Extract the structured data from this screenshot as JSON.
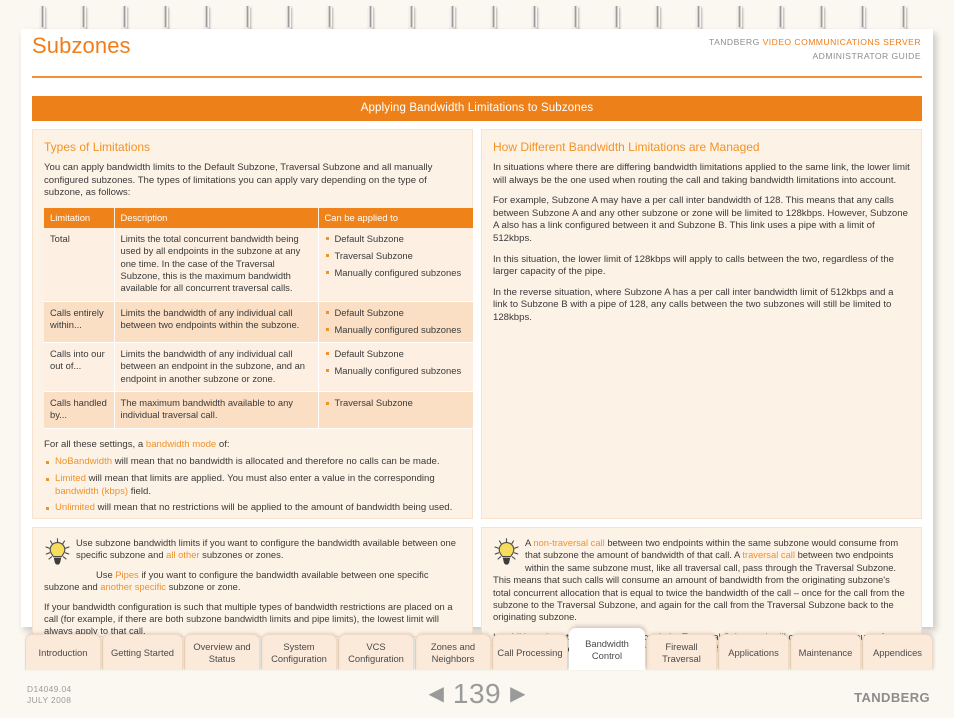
{
  "document": {
    "title": "Subzones",
    "header_company": "TANDBERG ",
    "header_product": "VIDEO COMMUNICATIONS SERVER",
    "header_subtitle": "ADMINISTRATOR GUIDE",
    "banner": "Applying Bandwidth Limitations to Subzones"
  },
  "left": {
    "section_title": "Types of Limitations",
    "intro": "You can apply bandwidth limits to the Default Subzone, Traversal Subzone and all manually configured subzones.  The types of limitations you can apply vary depending on the type of subzone, as follows:",
    "table": {
      "headers": [
        "Limitation",
        "Description",
        "Can be applied to"
      ],
      "rows": [
        {
          "limitation": "Total",
          "description": "Limits the total concurrent bandwidth being used by all endpoints in the subzone at any one time.  In the case of the Traversal Subzone, this is the maximum bandwidth available for all concurrent traversal calls.",
          "applies": [
            "Default Subzone",
            "Traversal Subzone",
            "Manually configured subzones"
          ]
        },
        {
          "limitation": "Calls entirely within...",
          "description": "Limits the bandwidth of any individual call between two endpoints within the subzone.",
          "applies": [
            "Default Subzone",
            "Manually configured subzones"
          ]
        },
        {
          "limitation": "Calls into our out of...",
          "description": "Limits the bandwidth of any individual call between an endpoint in the subzone, and an endpoint in another subzone or zone.",
          "applies": [
            "Default Subzone",
            "Manually configured subzones"
          ]
        },
        {
          "limitation": "Calls handled by...",
          "description": "The maximum bandwidth available to any individual traversal call.",
          "applies": [
            "Traversal Subzone"
          ]
        }
      ]
    },
    "modes_intro_a": "For all these settings, a ",
    "modes_intro_link": "bandwidth mode",
    "modes_intro_b": " of:",
    "modes": [
      {
        "term": "NoBandwidth",
        "rest": " will mean that no bandwidth is allocated and therefore no calls can be made."
      },
      {
        "term": "Limited",
        "rest": " will mean that limits are applied.  You must also enter a value in the corresponding ",
        "link2": "bandwidth (kbps)",
        "rest2": " field."
      },
      {
        "term": "Unlimited",
        "rest": " will mean that no restrictions will be applied to the amount of bandwidth being used."
      }
    ]
  },
  "right": {
    "section_title": "How Different Bandwidth Limitations are Managed",
    "paragraphs": [
      "In situations where there are differing bandwidth limitations applied to the same link, the lower limit will always be the one used when routing the call and taking bandwidth limitations into account.",
      "For example, Subzone A may have a per call inter bandwidth of 128.  This means that any calls between Subzone A and any other subzone or zone will be limited to 128kbps.  However, Subzone A also has a link configured between it and Subzone B.  This link uses a pipe with a limit of 512kbps.",
      "In this situation, the lower limit of 128kbps will apply to calls between the two, regardless of the larger capacity of the pipe.",
      "In the reverse situation, where Subzone A has a per call inter bandwidth limit of 512kbps and a link to Subzone B with a pipe of 128, any calls between the two subzones will still be limited to 128kbps."
    ]
  },
  "tip_left": {
    "icon": "lightbulb-icon",
    "p1_a": "Use subzone bandwidth limits if you want to configure the bandwidth available between one specific subzone and ",
    "p1_link": "all other",
    "p1_b": " subzones or zones.",
    "p2_a": "Use ",
    "p2_link": "Pipes",
    "p2_b": " if you want to configure the bandwidth available between one specific subzone and ",
    "p2_link2": "another specific",
    "p2_c": " subzone or zone.",
    "p3": "If your bandwidth configuration is such that multiple types of bandwidth restrictions are placed on a call (for example, if there are both subzone bandwidth limits and pipe limits), the lowest limit will always apply to that call."
  },
  "tip_right": {
    "icon": "lightbulb-icon",
    "p1_a": "A ",
    "p1_link": "non-traversal call",
    "p1_b": " between two endpoints within the same subzone would consume from that subzone the amount of bandwidth of that call.  A ",
    "p1_link2": "traversal call",
    "p1_c": " between two endpoints within the same subzone must, like all traversal call, pass through the Traversal Subzone. This means that such calls will consume an amount of bandwidth from the originating subzone's total concurrent allocation that is equal to twice the bandwidth of the call – once for the call from the subzone to the Traversal Subzone, and again for the call from the Traversal Subzone back to the originating subzone.",
    "p2": "In addition, since this call passes through the Traversal Subzone, it will consume an amount of bandwidth from the Traversal Subzone equal to that of the call."
  },
  "tabs": [
    {
      "label": "Introduction",
      "active": false
    },
    {
      "label": "Getting Started",
      "active": false
    },
    {
      "label": "Overview and Status",
      "active": false
    },
    {
      "label": "System Configuration",
      "active": false
    },
    {
      "label": "VCS Configuration",
      "active": false
    },
    {
      "label": "Zones and Neighbors",
      "active": false
    },
    {
      "label": "Call Processing",
      "active": false
    },
    {
      "label": "Bandwidth Control",
      "active": true
    },
    {
      "label": "Firewall Traversal",
      "active": false
    },
    {
      "label": "Applications",
      "active": false
    },
    {
      "label": "Maintenance",
      "active": false
    },
    {
      "label": "Appendices",
      "active": false
    }
  ],
  "footer": {
    "doc_id": "D14049.04",
    "date": "JULY 2008",
    "page_number": "139",
    "prev_arrow": "◀",
    "next_arrow": "▶",
    "brand": "TANDBERG"
  },
  "colors": {
    "accent_orange": "#ee8019",
    "title_orange": "#f07d18",
    "panel_bg": "#fdf2e6",
    "page_bg": "#fbf8f2"
  }
}
